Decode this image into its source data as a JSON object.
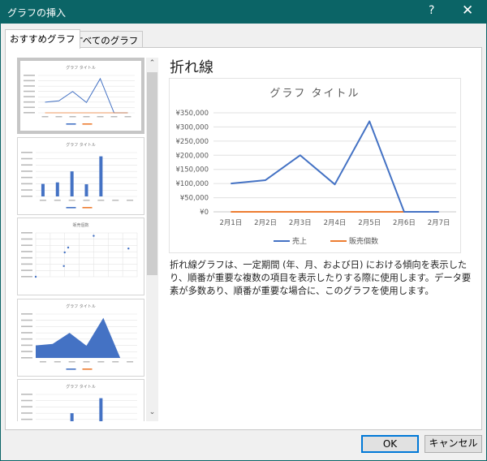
{
  "window": {
    "title": "グラフの挿入",
    "help": "?",
    "close": "✕"
  },
  "tabs": [
    {
      "label": "おすすめグラフ",
      "active": true
    },
    {
      "label": "すべてのグラフ",
      "active": false
    }
  ],
  "thumbnails": [
    {
      "type": "line",
      "title": "グラフ タイトル",
      "selected": true
    },
    {
      "type": "clustered-column",
      "title": "グラフ タイトル"
    },
    {
      "type": "scatter",
      "title": "販売個数"
    },
    {
      "type": "area",
      "title": "グラフ タイトル"
    },
    {
      "type": "column",
      "title": "グラフ タイトル"
    }
  ],
  "preview": {
    "heading": "折れ線",
    "description": "折れ線グラフは、一定期間 (年、月、および日) における傾向を表示したり、順番が重要な複数の項目を表示したりする際に使用します。データ要素が多数あり、順番が重要な場合に、このグラフを使用します。"
  },
  "chart_data": {
    "type": "line",
    "title": "グラフ タイトル",
    "categories": [
      "2月1日",
      "2月2日",
      "2月3日",
      "2月4日",
      "2月5日",
      "2月6日",
      "2月7日"
    ],
    "ylim": [
      0,
      350000
    ],
    "yticks": [
      "¥0",
      "¥50,000",
      "¥100,000",
      "¥150,000",
      "¥200,000",
      "¥250,000",
      "¥300,000",
      "¥350,000"
    ],
    "series": [
      {
        "name": "売上",
        "color": "#4472c4",
        "values": [
          100000,
          112000,
          200000,
          97000,
          320000,
          0,
          0
        ]
      },
      {
        "name": "販売個数",
        "color": "#ed7d31",
        "values": [
          25,
          30,
          42,
          11,
          29,
          0,
          0
        ]
      }
    ],
    "grid": true,
    "legend": "bottom"
  },
  "buttons": {
    "ok": "OK",
    "cancel": "キャンセル"
  },
  "scroll": {
    "up": "⌃",
    "down": "⌄"
  }
}
